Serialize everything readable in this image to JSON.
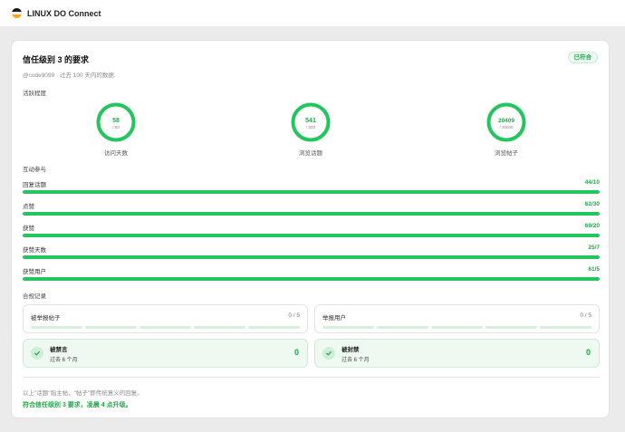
{
  "header": {
    "brand": "LINUX DO Connect",
    "logo_colors": [
      "#1c1c1e",
      "#f0f0f0",
      "#f5a623"
    ]
  },
  "card": {
    "title": "信任级别 3 的要求",
    "badge": "已符合",
    "subtitle": "@code9099 · 过去 100 天内的数据",
    "activity_title": "活跃程度",
    "rings": [
      {
        "value": "58",
        "target": "/ 50",
        "label": "访问天数",
        "fraction": 1.0
      },
      {
        "value": "541",
        "target": "/ 500",
        "label": "浏览话题",
        "fraction": 1.0
      },
      {
        "value": "20409",
        "target": "/ 20000",
        "label": "浏览帖子",
        "fraction": 1.0
      }
    ],
    "interaction_title": "互动参与",
    "bars": [
      {
        "label": "回复话题",
        "value": "44/10",
        "fraction": 1.0
      },
      {
        "label": "点赞",
        "value": "62/30",
        "fraction": 1.0
      },
      {
        "label": "获赞",
        "value": "69/20",
        "fraction": 1.0
      },
      {
        "label": "获赞天数",
        "value": "25/7",
        "fraction": 1.0
      },
      {
        "label": "获赞用户",
        "value": "61/5",
        "fraction": 1.0
      }
    ],
    "compliance_title": "合规记录",
    "reports": [
      {
        "label": "被举报帖子",
        "value": "0 / 5"
      },
      {
        "label": "举报用户",
        "value": "0 / 5"
      }
    ],
    "penalties": [
      {
        "title": "被禁言",
        "period": "过去 6 个月",
        "value": "0"
      },
      {
        "title": "被封禁",
        "period": "过去 6 个月",
        "value": "0"
      }
    ],
    "note": "以上\"话题\"指主帖，\"帖子\"即传统意义的回复。",
    "result": "符合信任级别 3 要求，凌晨 4 点升级。",
    "accent": "#22c55e"
  }
}
